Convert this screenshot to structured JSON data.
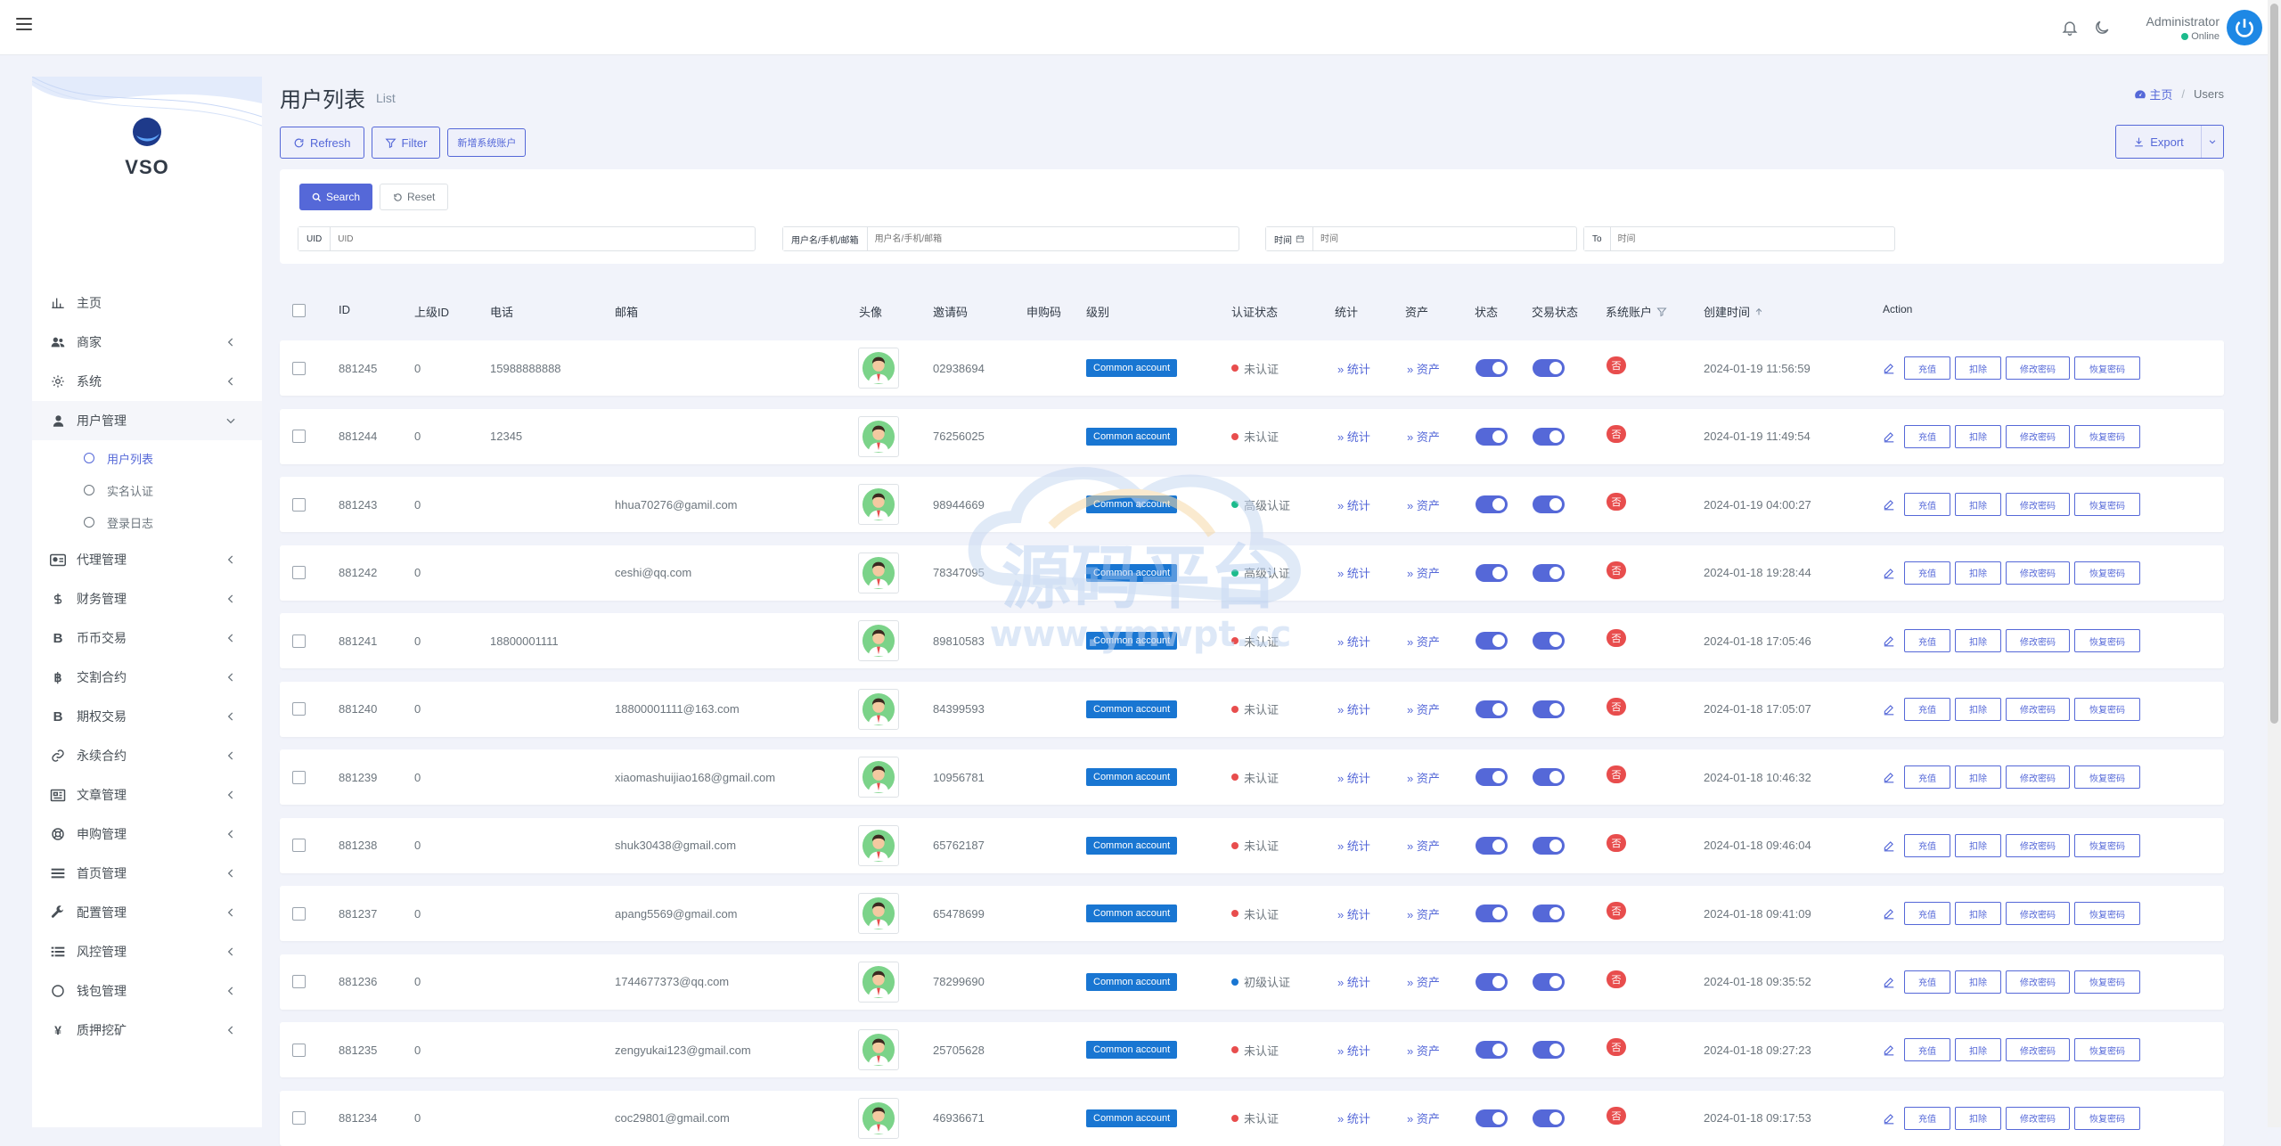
{
  "app": {
    "logo_text": "VSO"
  },
  "topbar": {
    "admin_name": "Administrator",
    "admin_status": "Online"
  },
  "sidebar": {
    "items": [
      {
        "label": "主页",
        "icon": "chart-bar-icon",
        "has_chevron": false
      },
      {
        "label": "商家",
        "icon": "users-icon",
        "has_chevron": true
      },
      {
        "label": "系统",
        "icon": "gear-icon",
        "has_chevron": true
      },
      {
        "label": "用户管理",
        "icon": "user-icon",
        "has_chevron": true,
        "open": true,
        "children": [
          {
            "label": "用户列表",
            "active": true
          },
          {
            "label": "实名认证",
            "active": false
          },
          {
            "label": "登录日志",
            "active": false
          }
        ]
      },
      {
        "label": "代理管理",
        "icon": "id-card-icon",
        "has_chevron": true
      },
      {
        "label": "财务管理",
        "icon": "dollar-icon",
        "has_chevron": true
      },
      {
        "label": "币币交易",
        "icon": "bitcoin-b-icon",
        "has_chevron": true
      },
      {
        "label": "交割合约",
        "icon": "bitcoin-icon",
        "has_chevron": true
      },
      {
        "label": "期权交易",
        "icon": "bitcoin-b-icon",
        "has_chevron": true
      },
      {
        "label": "永续合约",
        "icon": "link-icon",
        "has_chevron": true
      },
      {
        "label": "文章管理",
        "icon": "newspaper-icon",
        "has_chevron": true
      },
      {
        "label": "申购管理",
        "icon": "life-ring-icon",
        "has_chevron": true
      },
      {
        "label": "首页管理",
        "icon": "bars-icon",
        "has_chevron": true
      },
      {
        "label": "配置管理",
        "icon": "wrench-icon",
        "has_chevron": true
      },
      {
        "label": "风控管理",
        "icon": "list-icon",
        "has_chevron": true
      },
      {
        "label": "钱包管理",
        "icon": "circle-icon",
        "has_chevron": true
      },
      {
        "label": "质押挖矿",
        "icon": "yen-icon",
        "has_chevron": true
      }
    ]
  },
  "page": {
    "title": "用户列表",
    "subtitle": "List"
  },
  "breadcrumb": {
    "home": "主页",
    "separator": "/",
    "current": "Users"
  },
  "toolbar": {
    "refresh": "Refresh",
    "filter": "Filter",
    "new_system_account": "新增系统账户",
    "export": "Export"
  },
  "filters": {
    "search": "Search",
    "reset": "Reset",
    "uid_label": "UID",
    "uid_placeholder": "UID",
    "user_label": "用户名/手机/邮箱",
    "user_placeholder": "用户名/手机/邮箱",
    "time_label": "时间",
    "time_placeholder": "时间",
    "to_label": "To",
    "to_placeholder": "时间"
  },
  "table": {
    "headers": {
      "id": "ID",
      "parent": "上级ID",
      "phone": "电话",
      "email": "邮箱",
      "avatar": "头像",
      "invite": "邀请码",
      "subscribe": "申购码",
      "level": "级别",
      "auth": "认证状态",
      "stats": "统计",
      "assets": "资产",
      "status": "状态",
      "trade_status": "交易状态",
      "system_account": "系统账户",
      "created": "创建时间",
      "action": "Action"
    },
    "rows": [
      {
        "id": "881245",
        "parent": "0",
        "phone": "15988888888",
        "email": "",
        "invite": "02938694",
        "level": "Common account",
        "auth": "未认证",
        "auth_color": "#e84d4d",
        "stats": "统计",
        "assets": "资产",
        "system": "否",
        "created": "2024-01-19 11:56:59"
      },
      {
        "id": "881244",
        "parent": "0",
        "phone": "12345",
        "email": "",
        "invite": "76256025",
        "level": "Common account",
        "auth": "未认证",
        "auth_color": "#e84d4d",
        "stats": "统计",
        "assets": "资产",
        "system": "否",
        "created": "2024-01-19 11:49:54"
      },
      {
        "id": "881243",
        "parent": "0",
        "phone": "",
        "email": "hhua70276@gamil.com",
        "invite": "98944669",
        "level": "Common account",
        "auth": "高级认证",
        "auth_color": "#1cbb8c",
        "stats": "统计",
        "assets": "资产",
        "system": "否",
        "created": "2024-01-19 04:00:27"
      },
      {
        "id": "881242",
        "parent": "0",
        "phone": "",
        "email": "ceshi@qq.com",
        "invite": "78347095",
        "level": "Common account",
        "auth": "高级认证",
        "auth_color": "#1cbb8c",
        "stats": "统计",
        "assets": "资产",
        "system": "否",
        "created": "2024-01-18 19:28:44"
      },
      {
        "id": "881241",
        "parent": "0",
        "phone": "18800001111",
        "email": "",
        "invite": "89810583",
        "level": "Common account",
        "auth": "未认证",
        "auth_color": "#e84d4d",
        "stats": "统计",
        "assets": "资产",
        "system": "否",
        "created": "2024-01-18 17:05:46"
      },
      {
        "id": "881240",
        "parent": "0",
        "phone": "",
        "email": "18800001111@163.com",
        "invite": "84399593",
        "level": "Common account",
        "auth": "未认证",
        "auth_color": "#e84d4d",
        "stats": "统计",
        "assets": "资产",
        "system": "否",
        "created": "2024-01-18 17:05:07"
      },
      {
        "id": "881239",
        "parent": "0",
        "phone": "",
        "email": "xiaomashuijiao168@gmail.com",
        "invite": "10956781",
        "level": "Common account",
        "auth": "未认证",
        "auth_color": "#e84d4d",
        "stats": "统计",
        "assets": "资产",
        "system": "否",
        "created": "2024-01-18 10:46:32"
      },
      {
        "id": "881238",
        "parent": "0",
        "phone": "",
        "email": "shuk30438@gmail.com",
        "invite": "65762187",
        "level": "Common account",
        "auth": "未认证",
        "auth_color": "#e84d4d",
        "stats": "统计",
        "assets": "资产",
        "system": "否",
        "created": "2024-01-18 09:46:04"
      },
      {
        "id": "881237",
        "parent": "0",
        "phone": "",
        "email": "apang5569@gmail.com",
        "invite": "65478699",
        "level": "Common account",
        "auth": "未认证",
        "auth_color": "#e84d4d",
        "stats": "统计",
        "assets": "资产",
        "system": "否",
        "created": "2024-01-18 09:41:09"
      },
      {
        "id": "881236",
        "parent": "0",
        "phone": "",
        "email": "1744677373@qq.com",
        "invite": "78299690",
        "level": "Common account",
        "auth": "初级认证",
        "auth_color": "#1976d2",
        "stats": "统计",
        "assets": "资产",
        "system": "否",
        "created": "2024-01-18 09:35:52"
      },
      {
        "id": "881235",
        "parent": "0",
        "phone": "",
        "email": "zengyukai123@gmail.com",
        "invite": "25705628",
        "level": "Common account",
        "auth": "未认证",
        "auth_color": "#e84d4d",
        "stats": "统计",
        "assets": "资产",
        "system": "否",
        "created": "2024-01-18 09:27:23"
      },
      {
        "id": "881234",
        "parent": "0",
        "phone": "",
        "email": "coc29801@gmail.com",
        "invite": "46936671",
        "level": "Common account",
        "auth": "未认证",
        "auth_color": "#e84d4d",
        "stats": "统计",
        "assets": "资产",
        "system": "否",
        "created": "2024-01-18 09:17:53"
      }
    ],
    "actions": [
      "充值",
      "扣除",
      "修改密码",
      "恢复密码"
    ]
  },
  "watermark": {
    "text": "源码平台",
    "url": "www.ymwpt.cc"
  },
  "colors": {
    "primary": "#5568d8",
    "danger": "#e84d4d",
    "success": "#1cbb8c",
    "info": "#1976d2"
  }
}
